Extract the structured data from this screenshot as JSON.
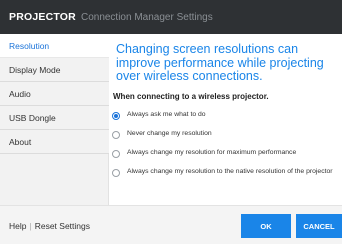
{
  "title_bar": {
    "brand": "PROJECTOR",
    "subtitle": "Connection Manager Settings"
  },
  "sidebar": {
    "items": [
      {
        "label": "Resolution",
        "active": true
      },
      {
        "label": "Display Mode",
        "active": false
      },
      {
        "label": "Audio",
        "active": false
      },
      {
        "label": "USB Dongle",
        "active": false
      },
      {
        "label": "About",
        "active": false
      }
    ]
  },
  "main": {
    "heading": "Changing screen resolutions can improve performance while projecting over wireless connections.",
    "subheading": "When connecting to a wireless projector.",
    "options": [
      {
        "label": "Always ask me what to do",
        "selected": true
      },
      {
        "label": "Never change my resolution",
        "selected": false
      },
      {
        "label": "Always change my resolution for maximum performance",
        "selected": false
      },
      {
        "label": "Always change my resolution to the native resolution of the projector",
        "selected": false
      }
    ]
  },
  "footer": {
    "help_label": "Help",
    "separator": "|",
    "reset_label": "Reset Settings",
    "ok_label": "OK",
    "cancel_label": "CANCEL"
  },
  "colors": {
    "accent": "#1a85e8",
    "titlebar_bg": "#2e3134",
    "sidebar_bg": "#f2f2f2"
  }
}
